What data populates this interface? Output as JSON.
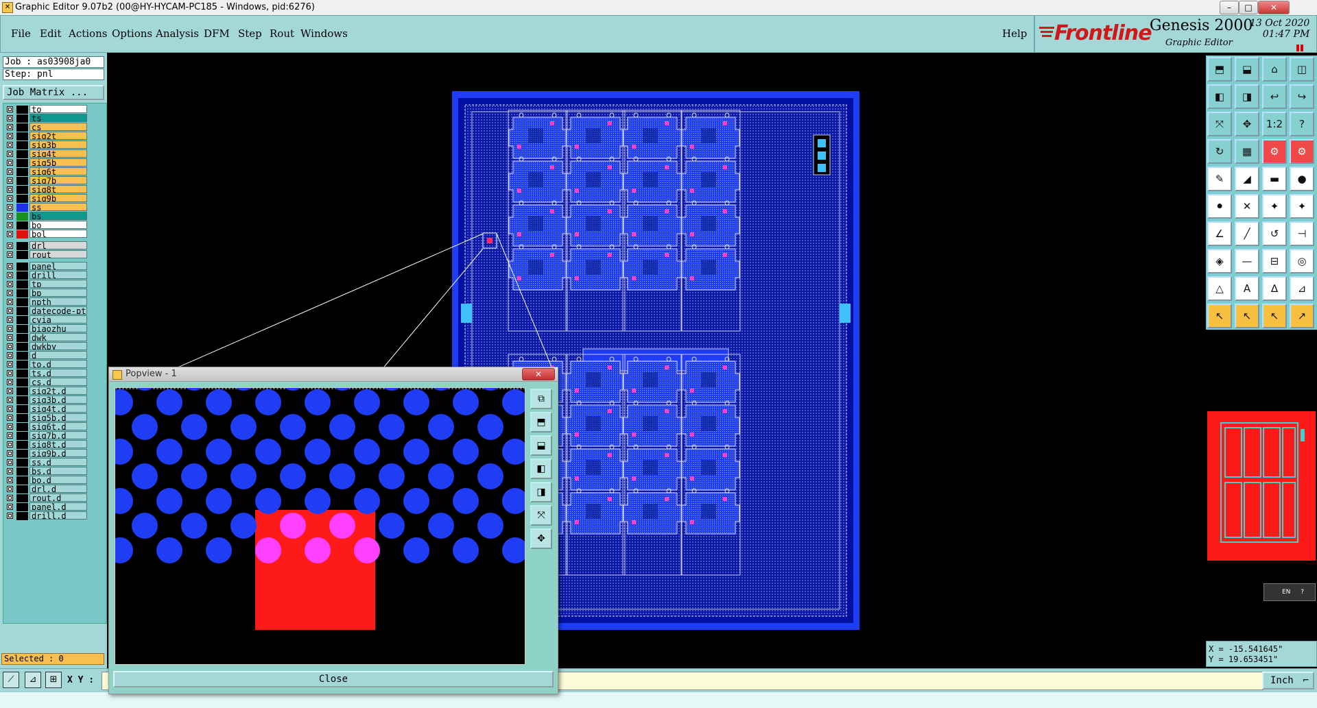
{
  "window": {
    "title": "Graphic Editor 9.07b2 (00@HY-HYCAM-PC185 - Windows, pid:6276)",
    "buttons": {
      "minimize": "–",
      "maximize": "□",
      "close": "✕"
    }
  },
  "menubar": {
    "items": [
      "File",
      "Edit",
      "Actions",
      "Options",
      "Analysis",
      "DFM",
      "Step",
      "Rout",
      "Windows"
    ],
    "help": "Help"
  },
  "logo": {
    "brand": "Frontline",
    "product": "Genesis 2000",
    "subtitle": "Graphic Editor",
    "date": "13 Oct 2020",
    "time": "01:47 PM"
  },
  "left": {
    "job": "Job : as03908ja0",
    "step": "Step: pnl",
    "job_matrix": "Job Matrix ...",
    "selected": "Selected : 0",
    "layers": [
      {
        "name": "to",
        "swatch": "#000000",
        "bg": "#ffffff"
      },
      {
        "name": "ts",
        "swatch": "#000000",
        "bg": "#109890"
      },
      {
        "name": "cs",
        "swatch": "#000000",
        "bg": "#f8c050"
      },
      {
        "name": "sig2t",
        "swatch": "#000000",
        "bg": "#f8c050"
      },
      {
        "name": "sig3b",
        "swatch": "#000000",
        "bg": "#f8c050"
      },
      {
        "name": "sig4t",
        "swatch": "#000000",
        "bg": "#f8c050"
      },
      {
        "name": "sig5b",
        "swatch": "#000000",
        "bg": "#f8c050"
      },
      {
        "name": "sig6t",
        "swatch": "#000000",
        "bg": "#f8c050"
      },
      {
        "name": "sig7b",
        "swatch": "#000000",
        "bg": "#f8c050"
      },
      {
        "name": "sig8t",
        "swatch": "#000000",
        "bg": "#f8c050"
      },
      {
        "name": "sig9b",
        "swatch": "#000000",
        "bg": "#f8c050"
      },
      {
        "name": "ss",
        "swatch": "#2030f0",
        "bg": "#f8c050"
      },
      {
        "name": "bs",
        "swatch": "#189020",
        "bg": "#109890"
      },
      {
        "name": "bo",
        "swatch": "#000000",
        "bg": "#ffffff"
      },
      {
        "name": "bol",
        "swatch": "#e01010",
        "bg": "#ffffff",
        "active": true
      },
      {
        "name": "drl",
        "swatch": "#000000",
        "bg": "#d8d8d8"
      },
      {
        "name": "rout",
        "swatch": "#000000",
        "bg": "#d8d8d8"
      },
      {
        "name": "panel",
        "swatch": "#000000",
        "bg": "#a4d8d8"
      },
      {
        "name": "drill",
        "swatch": "#000000",
        "bg": "#a4d8d8"
      },
      {
        "name": "tp",
        "swatch": "#000000",
        "bg": "#a4d8d8"
      },
      {
        "name": "bp",
        "swatch": "#000000",
        "bg": "#a4d8d8"
      },
      {
        "name": "npth",
        "swatch": "#000000",
        "bg": "#a4d8d8"
      },
      {
        "name": "datecode-pto",
        "swatch": "#000000",
        "bg": "#a4d8d8"
      },
      {
        "name": "cvia",
        "swatch": "#000000",
        "bg": "#a4d8d8"
      },
      {
        "name": "biaozhu",
        "swatch": "#000000",
        "bg": "#a4d8d8"
      },
      {
        "name": "dwk",
        "swatch": "#000000",
        "bg": "#a4d8d8"
      },
      {
        "name": "dwkby",
        "swatch": "#000000",
        "bg": "#a4d8d8"
      },
      {
        "name": "d",
        "swatch": "#000000",
        "bg": "#a4d8d8"
      },
      {
        "name": "to.d",
        "swatch": "#000000",
        "bg": "#a4d8d8"
      },
      {
        "name": "ts.d",
        "swatch": "#000000",
        "bg": "#a4d8d8"
      },
      {
        "name": "cs.d",
        "swatch": "#000000",
        "bg": "#a4d8d8"
      },
      {
        "name": "sig2t.d",
        "swatch": "#000000",
        "bg": "#a4d8d8"
      },
      {
        "name": "sig3b.d",
        "swatch": "#000000",
        "bg": "#a4d8d8"
      },
      {
        "name": "sig4t.d",
        "swatch": "#000000",
        "bg": "#a4d8d8"
      },
      {
        "name": "sig5b.d",
        "swatch": "#000000",
        "bg": "#a4d8d8"
      },
      {
        "name": "sig6t.d",
        "swatch": "#000000",
        "bg": "#a4d8d8"
      },
      {
        "name": "sig7b.d",
        "swatch": "#000000",
        "bg": "#a4d8d8"
      },
      {
        "name": "sig8t.d",
        "swatch": "#000000",
        "bg": "#a4d8d8"
      },
      {
        "name": "sig9b.d",
        "swatch": "#000000",
        "bg": "#a4d8d8"
      },
      {
        "name": "ss.d",
        "swatch": "#000000",
        "bg": "#a4d8d8"
      },
      {
        "name": "bs.d",
        "swatch": "#000000",
        "bg": "#a4d8d8"
      },
      {
        "name": "bo.d",
        "swatch": "#000000",
        "bg": "#a4d8d8"
      },
      {
        "name": "drl.d",
        "swatch": "#000000",
        "bg": "#a4d8d8"
      },
      {
        "name": "rout.d",
        "swatch": "#000000",
        "bg": "#a4d8d8"
      },
      {
        "name": "panel.d",
        "swatch": "#000000",
        "bg": "#a4d8d8"
      },
      {
        "name": "drill.d",
        "swatch": "#000000",
        "bg": "#a4d8d8"
      }
    ]
  },
  "bottom": {
    "xy_label": "X Y :",
    "unit": "Inch"
  },
  "right": {
    "lang": "EN",
    "x": "X = -15.541645\"",
    "y": "Y =  19.653451\""
  },
  "popview": {
    "title": "Popview - 1",
    "close_label": "Close"
  },
  "colors": {
    "panel": "#a4d8d8",
    "pad_blue": "#1f3df5",
    "highlight_red": "#ff1a1a",
    "highlight_magenta": "#ff40ff"
  }
}
